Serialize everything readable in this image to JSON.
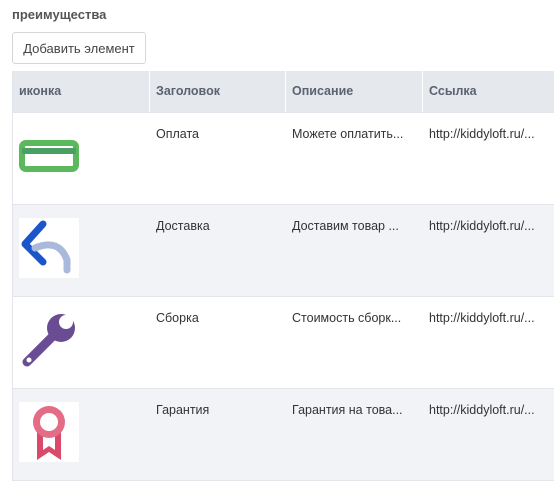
{
  "section": {
    "title": "преимущества"
  },
  "toolbar": {
    "add_label": "Добавить элемент"
  },
  "table": {
    "columns": [
      "иконка",
      "Заголовок",
      "Описание",
      "Ссылка"
    ],
    "rows": [
      {
        "icon": "credit-card-icon",
        "title": "Оплата",
        "description": "Можете оплатить...",
        "link": "http://kiddyloft.ru/..."
      },
      {
        "icon": "return-arrow-icon",
        "title": "Доставка",
        "description": "Доставим товар ...",
        "link": "http://kiddyloft.ru/..."
      },
      {
        "icon": "wrench-icon",
        "title": "Сборка",
        "description": "Стоимость сборк...",
        "link": "http://kiddyloft.ru/..."
      },
      {
        "icon": "award-ribbon-icon",
        "title": "Гарантия",
        "description": "Гарантия на това...",
        "link": "http://kiddyloft.ru/..."
      }
    ]
  },
  "colors": {
    "card_green": "#5cb85c",
    "arrow_blue": "#1a56c9",
    "arrow_light": "#a9b9dc",
    "wrench_purple": "#6a4c93",
    "ribbon_pink": "#d9496a"
  }
}
